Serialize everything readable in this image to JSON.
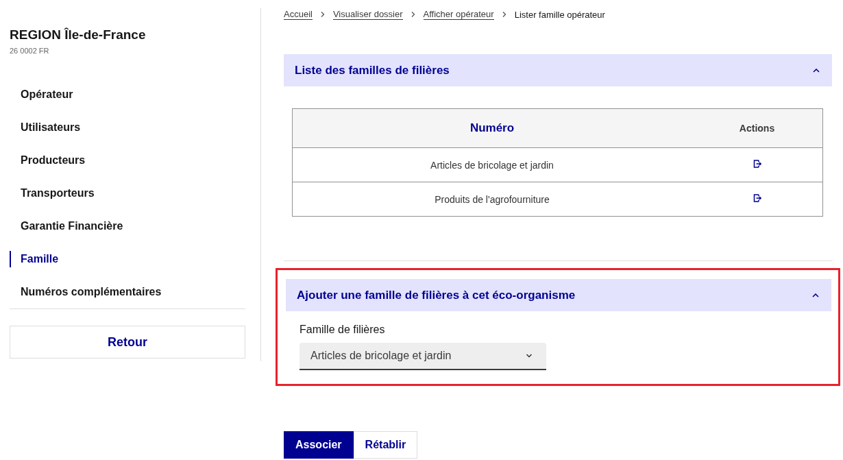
{
  "sidebar": {
    "title": "REGION Île-de-France",
    "subtitle": "26 0002 FR",
    "items": [
      {
        "label": "Opérateur",
        "selected": false
      },
      {
        "label": "Utilisateurs",
        "selected": false
      },
      {
        "label": "Producteurs",
        "selected": false
      },
      {
        "label": "Transporteurs",
        "selected": false
      },
      {
        "label": "Garantie Financière",
        "selected": false
      },
      {
        "label": "Famille",
        "selected": true
      },
      {
        "label": "Numéros complémentaires",
        "selected": false
      }
    ],
    "back_button": "Retour"
  },
  "breadcrumb": [
    {
      "label": "Accueil",
      "current": false
    },
    {
      "label": "Visualiser dossier",
      "current": false
    },
    {
      "label": "Afficher opérateur",
      "current": false
    },
    {
      "label": "Lister famille opérateur",
      "current": true
    }
  ],
  "list_section": {
    "title": "Liste des familles de filières",
    "expanded": true,
    "table": {
      "columns": [
        "Numéro",
        "Actions"
      ],
      "rows": [
        {
          "name": "Articles de bricolage et jardin"
        },
        {
          "name": "Produits de l'agrofourniture"
        }
      ]
    }
  },
  "add_section": {
    "title": "Ajouter une famille de filières à cet éco-organisme",
    "expanded": true,
    "highlighted": true,
    "field": {
      "label": "Famille de filières",
      "value": "Articles de bricolage et jardin"
    }
  },
  "buttons": [
    {
      "label": "Associer",
      "kind": "primary"
    },
    {
      "label": "Rétablir",
      "kind": "secondary"
    }
  ]
}
